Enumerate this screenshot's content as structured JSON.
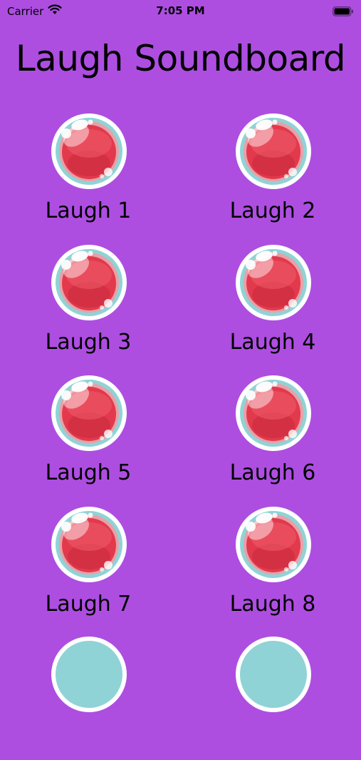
{
  "status_bar": {
    "carrier": "Carrier",
    "time": "7:05 PM",
    "icons": [
      "wifi-icon",
      "battery-icon"
    ]
  },
  "title": "Laugh Soundboard",
  "colors": {
    "background": "#ad4ee1",
    "button_red": "#e23a4c",
    "button_ring": "#8fd3d6"
  },
  "sounds": [
    {
      "label": "Laugh 1"
    },
    {
      "label": "Laugh 2"
    },
    {
      "label": "Laugh 3"
    },
    {
      "label": "Laugh 4"
    },
    {
      "label": "Laugh 5"
    },
    {
      "label": "Laugh 6"
    },
    {
      "label": "Laugh 7"
    },
    {
      "label": "Laugh 8"
    }
  ]
}
